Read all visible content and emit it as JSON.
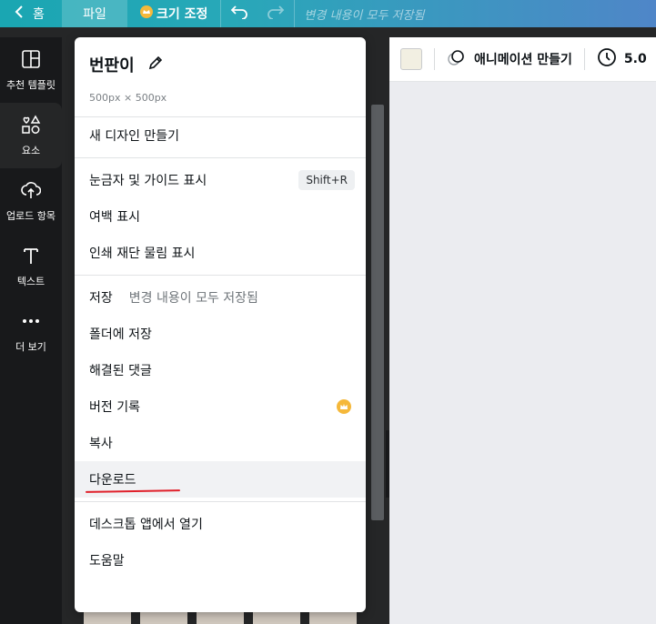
{
  "topbar": {
    "home_label": "홈",
    "file_label": "파일",
    "resize_label": "크기 조정",
    "status": "변경 내용이 모두 저장됨"
  },
  "rail": {
    "items": [
      {
        "label": "추천 템플릿",
        "icon": "template-icon"
      },
      {
        "label": "요소",
        "icon": "elements-icon"
      },
      {
        "label": "업로드 항목",
        "icon": "upload-icon"
      },
      {
        "label": "텍스트",
        "icon": "text-icon"
      },
      {
        "label": "더 보기",
        "icon": "more-icon"
      }
    ]
  },
  "toolbar": {
    "swatch_color": "#f2efe2",
    "animate_label": "애니메이션 만들기",
    "timer_label": "5.0"
  },
  "menu": {
    "title": "번판이",
    "size": "500px × 500px",
    "new_design": "새 디자인 만들기",
    "show_rulers": "눈금자 및 가이드 표시",
    "show_rulers_shortcut": "Shift+R",
    "show_margins": "여백 표시",
    "show_bleed": "인쇄 재단 물림 표시",
    "save": "저장",
    "save_status": "변경 내용이 모두 저장됨",
    "save_to_folder": "폴더에 저장",
    "resolved_comments": "해결된 댓글",
    "version_history": "버전 기록",
    "copy": "복사",
    "download": "다운로드",
    "open_desktop": "데스크톱 앱에서 열기",
    "help": "도움말"
  }
}
